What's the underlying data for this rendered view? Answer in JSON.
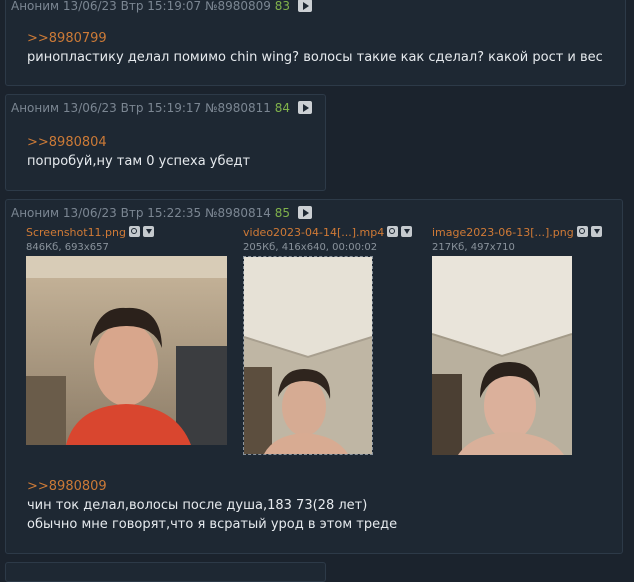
{
  "posts": [
    {
      "author": "Аноним",
      "date": "13/06/23 Втр 15:19:07",
      "id": "№8980809",
      "ordinal": "83",
      "reply_link": ">>8980799",
      "lines": [
        "ринопластику делал помимо chin wing? волосы такие как сделал? какой рост и вес"
      ]
    },
    {
      "author": "Аноним",
      "date": "13/06/23 Втр 15:19:17",
      "id": "№8980811",
      "ordinal": "84",
      "reply_link": ">>8980804",
      "lines": [
        "попробуй,ну там 0 успеха убедт"
      ]
    },
    {
      "author": "Аноним",
      "date": "13/06/23 Втр 15:22:35",
      "id": "№8980814",
      "ordinal": "85",
      "reply_link": ">>8980809",
      "lines": [
        "чин ток делал,волосы после душа,183 73(28 лет)",
        "обычно мне говорят,что я всратый урод в этом треде"
      ],
      "files": [
        {
          "name": "Screenshot11.png",
          "info": "846Кб, 693x657"
        },
        {
          "name": "video2023-04-14[...].mp4",
          "info": "205Кб, 416x640, 00:00:02"
        },
        {
          "name": "image2023-06-13[...].png",
          "info": "217Кб, 497x710"
        }
      ]
    }
  ],
  "icons": {
    "reply": "play-triangle-icon",
    "search": "magnifier-icon",
    "download": "download-arrow-icon"
  },
  "colors": {
    "background": "#1b232d",
    "post_bg": "#1e2833",
    "reply_link": "#cc7a37",
    "ordinal": "#80b24b",
    "header_text": "#7b8692"
  }
}
